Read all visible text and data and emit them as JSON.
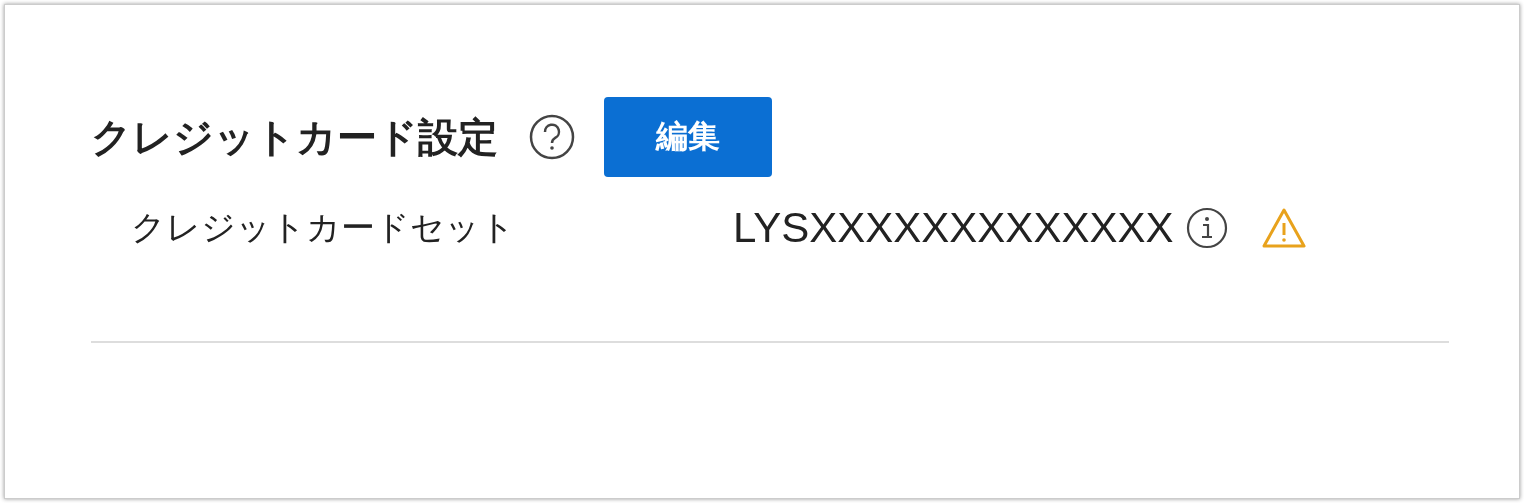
{
  "section": {
    "title": "クレジットカード設定",
    "edit_button": "編集"
  },
  "fields": [
    {
      "label": "クレジットカードセット",
      "value": "LYSXXXXXXXXXXXXX",
      "warning": true
    }
  ]
}
